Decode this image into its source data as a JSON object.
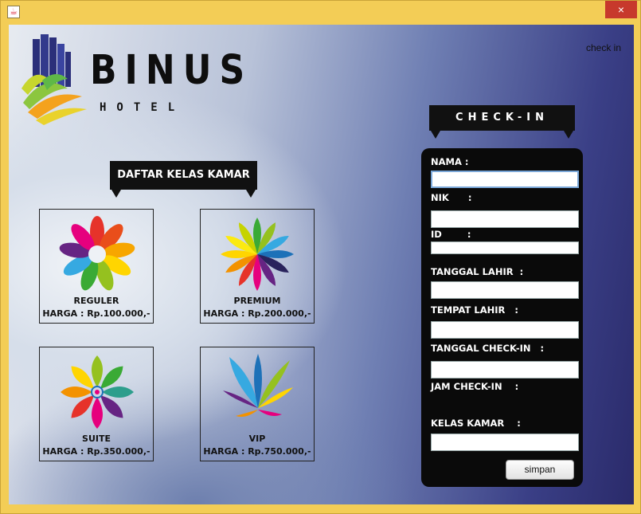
{
  "window": {
    "app_icon": "java-icon",
    "close_icon": "×"
  },
  "brand": {
    "word": "BINUS",
    "sub": "HOTEL"
  },
  "corner_label": "check in",
  "rooms_banner": "DAFTAR KELAS KAMAR",
  "rooms": [
    {
      "name": "REGULER",
      "price": "HARGA : Rp.100.000,-"
    },
    {
      "name": "PREMIUM",
      "price": "HARGA : Rp.200.000,-"
    },
    {
      "name": "SUITE",
      "price": "HARGA : Rp.350.000,-"
    },
    {
      "name": "VIP",
      "price": "HARGA : Rp.750.000,-"
    }
  ],
  "checkin": {
    "banner": "CHECK-IN",
    "labels": {
      "nama": "NAMA :",
      "nik": "NIK      :",
      "id": "ID        :",
      "tanggal_lahir": "TANGGAL LAHIR  :",
      "tempat_lahir": "TEMPAT LAHIR   :",
      "tanggal_checkin": "TANGGAL CHECK-IN   :",
      "jam_checkin": "JAM CHECK-IN    :",
      "kelas_kamar": "KELAS KAMAR    :"
    },
    "values": {
      "nama": "",
      "nik": "",
      "id": "",
      "tanggal_lahir": "",
      "tempat_lahir": "",
      "tanggal_checkin": "",
      "kelas_kamar": ""
    },
    "save_label": "simpan"
  }
}
